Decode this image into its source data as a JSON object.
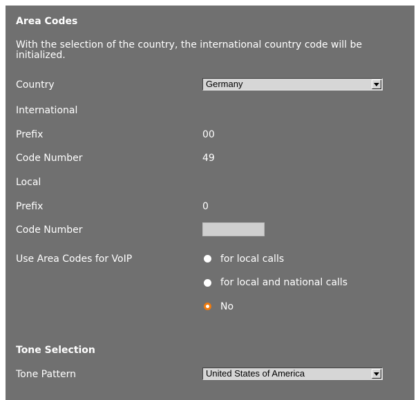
{
  "area_codes": {
    "heading": "Area Codes",
    "description": "With the selection of the country, the international country code will be initialized.",
    "country_label": "Country",
    "country_value": "Germany",
    "international_label": "International",
    "intl_prefix_label": "Prefix",
    "intl_prefix_value": "00",
    "intl_code_label": "Code Number",
    "intl_code_value": "49",
    "local_label": "Local",
    "local_prefix_label": "Prefix",
    "local_prefix_value": "0",
    "local_code_label": "Code Number",
    "local_code_value": "",
    "voip_label": "Use Area Codes for VoIP",
    "voip_options": [
      "for local calls",
      "for local and national calls",
      "No"
    ],
    "voip_selected": "No"
  },
  "tone_selection": {
    "heading": "Tone Selection",
    "pattern_label": "Tone Pattern",
    "pattern_value": "United States of America"
  },
  "colors": {
    "panel_bg": "#707070",
    "radio_selected": "#f07a0c",
    "text": "#ffffff"
  },
  "icons": {
    "dropdown": "chevron-down-icon",
    "radio": "radio-icon"
  }
}
